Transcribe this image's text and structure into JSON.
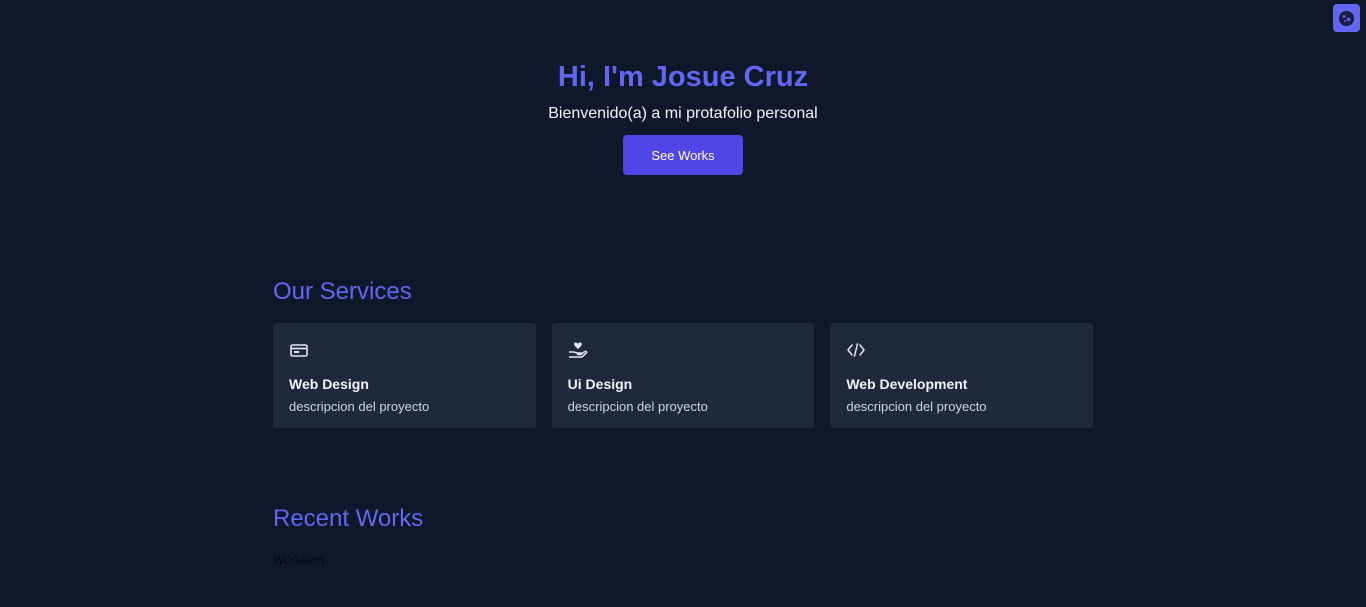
{
  "hero": {
    "title": "Hi, I'm Josue Cruz",
    "subtitle": "Bienvenido(a) a mi protafolio personal",
    "button_label": "See Works"
  },
  "theme_toggle": {
    "icon": "moon-icon"
  },
  "services": {
    "title": "Our Services",
    "items": [
      {
        "icon": "browser-window-icon",
        "title": "Web Design",
        "description": "descripcion del proyecto"
      },
      {
        "icon": "hand-heart-icon",
        "title": "Ui Design",
        "description": "descripcion del proyecto"
      },
      {
        "icon": "code-icon",
        "title": "Web Development",
        "description": "descripcion del proyecto"
      }
    ]
  },
  "works": {
    "title": "Recent Works",
    "item_label": "WorkItem"
  },
  "colors": {
    "background": "#0f172a",
    "accent": "#6366f1",
    "button": "#4f46e5",
    "card": "#1e293b"
  }
}
